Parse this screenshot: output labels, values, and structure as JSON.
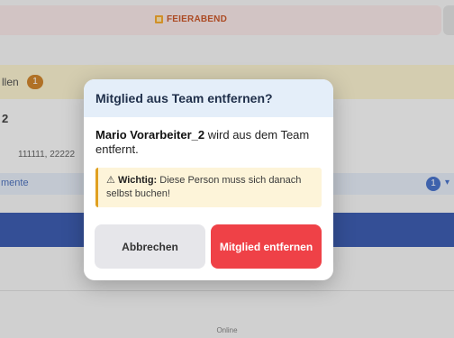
{
  "background": {
    "status_label": "FEIERABEND",
    "section_label": "llen",
    "section_badge": "1",
    "member_number": "2",
    "member_ids": "111111, 22222",
    "documents_label": "mente",
    "documents_badge": "1",
    "footer_status": "Online"
  },
  "modal": {
    "title": "Mitglied aus Team entfernen?",
    "member_name": "Mario Vorarbeiter_2",
    "message_rest": " wird aus dem Team entfernt.",
    "warning_prefix_icon": "⚠",
    "warning_label": "Wichtig:",
    "warning_text": " Diese Person muss sich danach selbst buchen!",
    "cancel_label": "Abbrechen",
    "remove_label": "Mitglied entfernen"
  },
  "colors": {
    "header_bg": "#e4eef9",
    "danger": "#ef4147",
    "warning_bg": "#fdf4d9",
    "warning_border": "#e0a020"
  }
}
